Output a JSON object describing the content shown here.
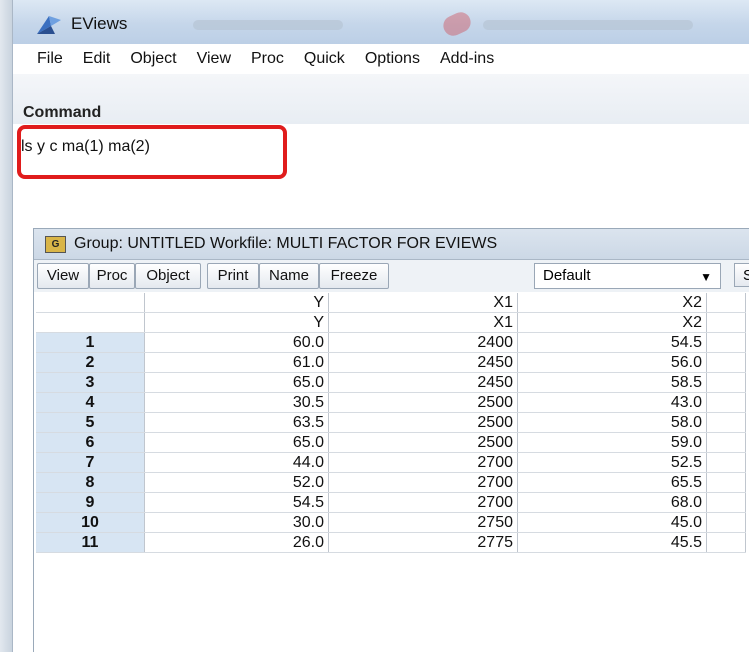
{
  "app": {
    "title": "EViews",
    "icon": "eviews-logo-icon"
  },
  "menu": [
    "File",
    "Edit",
    "Object",
    "View",
    "Proc",
    "Quick",
    "Options",
    "Add-ins"
  ],
  "command": {
    "label": "Command",
    "text": "ls y c ma(1) ma(2)",
    "highlight_color": "#e01c1c"
  },
  "group": {
    "title": "Group: UNTITLED   Workfile: MULTI FACTOR FOR EVIEWS",
    "icon_label": "G",
    "toolbar": [
      "View",
      "Proc",
      "Object",
      "Print",
      "Name",
      "Freeze"
    ],
    "dropdown_value": "Default",
    "extra_button": "S",
    "columns": [
      "Y",
      "X1",
      "X2"
    ],
    "subheaders": [
      "Y",
      "X1",
      "X2"
    ],
    "rows": [
      {
        "obs": "1",
        "y": "60.0",
        "x1": "2400",
        "x2": "54.5"
      },
      {
        "obs": "2",
        "y": "61.0",
        "x1": "2450",
        "x2": "56.0"
      },
      {
        "obs": "3",
        "y": "65.0",
        "x1": "2450",
        "x2": "58.5"
      },
      {
        "obs": "4",
        "y": "30.5",
        "x1": "2500",
        "x2": "43.0"
      },
      {
        "obs": "5",
        "y": "63.5",
        "x1": "2500",
        "x2": "58.0"
      },
      {
        "obs": "6",
        "y": "65.0",
        "x1": "2500",
        "x2": "59.0"
      },
      {
        "obs": "7",
        "y": "44.0",
        "x1": "2700",
        "x2": "52.5"
      },
      {
        "obs": "8",
        "y": "52.0",
        "x1": "2700",
        "x2": "65.5"
      },
      {
        "obs": "9",
        "y": "54.5",
        "x1": "2700",
        "x2": "68.0"
      },
      {
        "obs": "10",
        "y": "30.0",
        "x1": "2750",
        "x2": "45.0"
      },
      {
        "obs": "11",
        "y": "26.0",
        "x1": "2775",
        "x2": "45.5"
      }
    ]
  }
}
